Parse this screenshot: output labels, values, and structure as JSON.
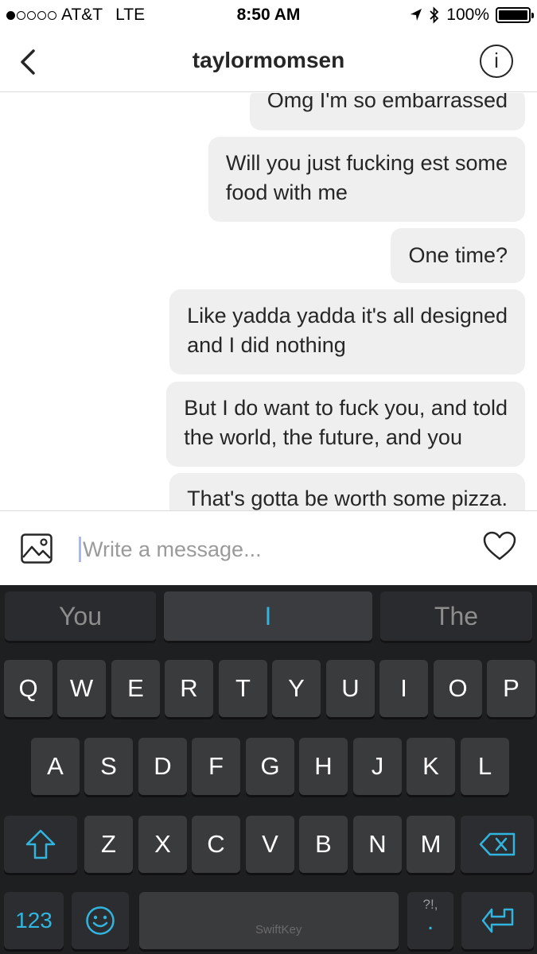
{
  "status_bar": {
    "carrier": "AT&T",
    "network": "LTE",
    "time": "8:50 AM",
    "battery": "100%",
    "signal_bars_filled": 1,
    "signal_bars_total": 5,
    "battery_level": 1.0
  },
  "nav": {
    "title": "taylormomsen",
    "info_label": "i"
  },
  "messages": [
    {
      "lines": [
        "Omg I'm so embarrassed"
      ]
    },
    {
      "lines": [
        "Will you just fucking est some",
        "food with me"
      ]
    },
    {
      "lines": [
        "One time?"
      ]
    },
    {
      "lines": [
        "Like yadda yadda it's all designed",
        "and I did nothing"
      ]
    },
    {
      "lines": [
        "But I do want to fuck you, and told",
        "the world, the future, and you"
      ]
    },
    {
      "lines": [
        "That's gotta be worth some pizza."
      ]
    }
  ],
  "composer": {
    "placeholder": "Write a message..."
  },
  "keyboard": {
    "suggestions": [
      "You",
      "I",
      "The"
    ],
    "row1": [
      "Q",
      "W",
      "E",
      "R",
      "T",
      "Y",
      "U",
      "I",
      "O",
      "P"
    ],
    "row2": [
      "A",
      "S",
      "D",
      "F",
      "G",
      "H",
      "J",
      "K",
      "L"
    ],
    "row3": [
      "Z",
      "X",
      "C",
      "V",
      "B",
      "N",
      "M"
    ],
    "numbers_label": "123",
    "punct_label": "?!,",
    "punct_dot": ".",
    "brand": "SwiftKey",
    "accent_color": "#31b5de"
  }
}
